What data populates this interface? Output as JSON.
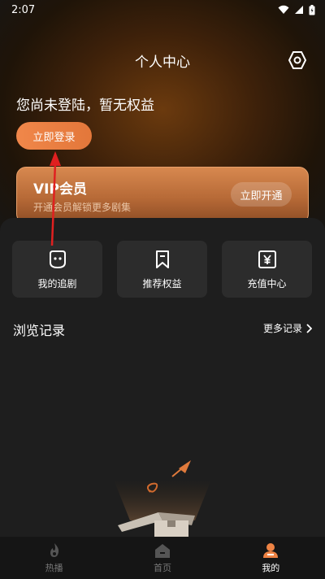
{
  "status_bar": {
    "time": "2:07"
  },
  "header": {
    "title": "个人中心"
  },
  "login": {
    "prompt": "您尚未登陆，暂无权益",
    "button_label": "立即登录"
  },
  "vip": {
    "title": "VIP会员",
    "subtitle": "开通会员解锁更多剧集",
    "button_label": "立即开通"
  },
  "quick_actions": [
    {
      "label": "我的追剧",
      "icon": "face-icon"
    },
    {
      "label": "推荐权益",
      "icon": "bookmark-icon"
    },
    {
      "label": "充值中心",
      "icon": "yen-icon"
    }
  ],
  "history": {
    "title": "浏览记录",
    "more_label": "更多记录"
  },
  "tabbar": {
    "items": [
      {
        "label": "热播",
        "icon": "flame-icon",
        "active": false
      },
      {
        "label": "首页",
        "icon": "home-icon",
        "active": false
      },
      {
        "label": "我的",
        "icon": "user-icon",
        "active": true
      }
    ]
  },
  "colors": {
    "accent": "#EE8344",
    "background": "#1C1C1C",
    "card": "#2C2C2C",
    "annotation": "#E02020"
  }
}
